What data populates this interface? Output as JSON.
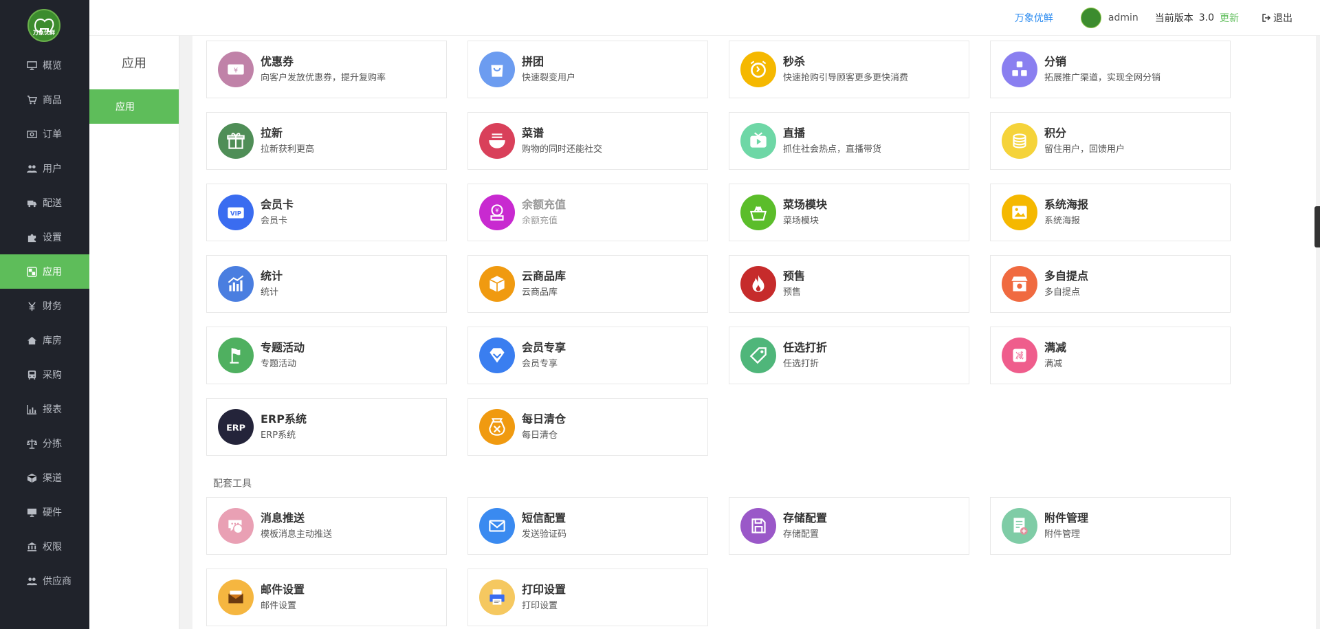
{
  "sidebar": {
    "logo_text": "万象优鲜",
    "items": [
      {
        "label": "概览",
        "icon": "monitor-icon",
        "active": false
      },
      {
        "label": "商品",
        "icon": "cart-icon",
        "active": false
      },
      {
        "label": "订单",
        "icon": "money-icon",
        "active": false
      },
      {
        "label": "用户",
        "icon": "users-icon",
        "active": false
      },
      {
        "label": "配送",
        "icon": "truck-icon",
        "active": false
      },
      {
        "label": "设置",
        "icon": "puzzle-icon",
        "active": false
      },
      {
        "label": "应用",
        "icon": "apps-icon",
        "active": true
      },
      {
        "label": "财务",
        "icon": "yen-icon",
        "active": false
      },
      {
        "label": "库房",
        "icon": "home-icon",
        "active": false
      },
      {
        "label": "采购",
        "icon": "bus-icon",
        "active": false
      },
      {
        "label": "报表",
        "icon": "bar-chart-icon",
        "active": false
      },
      {
        "label": "分拣",
        "icon": "scale-icon",
        "active": false
      },
      {
        "label": "渠道",
        "icon": "cube-icon",
        "active": false
      },
      {
        "label": "硬件",
        "icon": "desktop-icon",
        "active": false
      },
      {
        "label": "权限",
        "icon": "bank-icon",
        "active": false
      },
      {
        "label": "供应商",
        "icon": "users-icon",
        "active": false
      }
    ]
  },
  "subnav": {
    "title": "应用",
    "items": [
      {
        "label": "应用",
        "active": true
      }
    ]
  },
  "header": {
    "brand_link": "万象优鲜",
    "username": "admin",
    "version_label": "当前版本",
    "version": "3.0",
    "update_label": "更新",
    "logout_label": "退出"
  },
  "apps": [
    {
      "title": "优惠券",
      "desc": "向客户发放优惠券，提升复购率",
      "icon": "coupon-icon",
      "color": "#c082a8"
    },
    {
      "title": "拼团",
      "desc": "快速裂变用户",
      "icon": "shopping-bag-icon",
      "color": "#6c9cf0"
    },
    {
      "title": "秒杀",
      "desc": "快速抢购引导顾客更多更快消费",
      "icon": "alarm-clock-icon",
      "color": "#f5b800"
    },
    {
      "title": "分销",
      "desc": "拓展推广渠道，实现全网分销",
      "icon": "distribution-icon",
      "color": "#8a7ff0"
    },
    {
      "title": "拉新",
      "desc": "拉新获利更高",
      "icon": "gift-icon",
      "color": "#4f8e57"
    },
    {
      "title": "菜谱",
      "desc": "购物的同时还能社交",
      "icon": "bowl-icon",
      "color": "#d9405a"
    },
    {
      "title": "直播",
      "desc": "抓住社会热点，直播带货",
      "icon": "live-tv-icon",
      "color": "#6ed7a6"
    },
    {
      "title": "积分",
      "desc": "留住用户，回馈用户",
      "icon": "coins-icon",
      "color": "#f5d33a"
    },
    {
      "title": "会员卡",
      "desc": "会员卡",
      "icon": "vip-card-icon",
      "color": "#3a6cf0"
    },
    {
      "title": "余额充值",
      "desc": "余额充值",
      "icon": "recharge-icon",
      "color": "#c82ad0",
      "dim": true
    },
    {
      "title": "菜场模块",
      "desc": "菜场模块",
      "icon": "basket-icon",
      "color": "#5bbd2a"
    },
    {
      "title": "系统海报",
      "desc": "系统海报",
      "icon": "poster-icon",
      "color": "#f5b800"
    },
    {
      "title": "统计",
      "desc": "统计",
      "icon": "statistics-icon",
      "color": "#4a7ee0"
    },
    {
      "title": "云商品库",
      "desc": "云商品库",
      "icon": "box-icon",
      "color": "#f09a10"
    },
    {
      "title": "预售",
      "desc": "预售",
      "icon": "fire-icon",
      "color": "#c62b2b"
    },
    {
      "title": "多自提点",
      "desc": "多自提点",
      "icon": "store-icon",
      "color": "#f06a40"
    },
    {
      "title": "专题活动",
      "desc": "专题活动",
      "icon": "flag-icon",
      "color": "#4fb060"
    },
    {
      "title": "会员专享",
      "desc": "会员专享",
      "icon": "diamond-icon",
      "color": "#3a7ef0"
    },
    {
      "title": "任选打折",
      "desc": "任选打折",
      "icon": "tag-icon",
      "color": "#4fb67a"
    },
    {
      "title": "满减",
      "desc": "满减",
      "icon": "discount-icon",
      "color": "#ef5d8c"
    },
    {
      "title": "ERP系统",
      "desc": "ERP系统",
      "icon": "erp-icon",
      "color": "#24243a"
    },
    {
      "title": "每日清仓",
      "desc": "每日清仓",
      "icon": "clearance-icon",
      "color": "#f09a10"
    }
  ],
  "tools_section": {
    "label": "配套工具",
    "items": [
      {
        "title": "消息推送",
        "desc": "模板消息主动推送",
        "icon": "message-icon",
        "color": "#e9a0b4"
      },
      {
        "title": "短信配置",
        "desc": "发送验证码",
        "icon": "mail-icon",
        "color": "#3a8af0"
      },
      {
        "title": "存储配置",
        "desc": "存储配置",
        "icon": "save-icon",
        "color": "#9a58c8"
      },
      {
        "title": "附件管理",
        "desc": "附件管理",
        "icon": "attachment-icon",
        "color": "#7fcca6"
      },
      {
        "title": "邮件设置",
        "desc": "邮件设置",
        "icon": "envelope-icon",
        "color": "#f5b640"
      },
      {
        "title": "打印设置",
        "desc": "打印设置",
        "icon": "printer-icon",
        "color": "#f5c860"
      }
    ]
  }
}
